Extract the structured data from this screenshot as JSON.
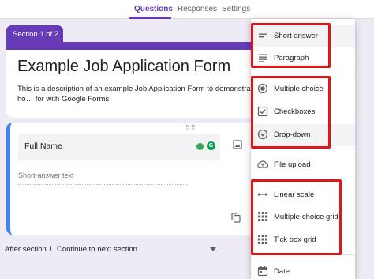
{
  "tabs": [
    {
      "label": "Questions",
      "active": true
    },
    {
      "label": "Responses",
      "active": false
    },
    {
      "label": "Settings",
      "active": false
    }
  ],
  "section_tab": "Section 1 of 2",
  "form": {
    "title": "Example Job Application Form",
    "description": "This is a description of an example Job Application Form to demonstrate ho… for with Google Forms."
  },
  "question": {
    "label": "Full Name",
    "placeholder": "Short-answer text",
    "badge": "G"
  },
  "after_section": {
    "label": "After section 1",
    "value": "Continue to next section"
  },
  "menu": {
    "items": [
      {
        "label": "Short answer",
        "icon": "short-answer-icon"
      },
      {
        "label": "Paragraph",
        "icon": "paragraph-icon"
      },
      {
        "label": "Multiple choice",
        "icon": "radio-icon"
      },
      {
        "label": "Checkboxes",
        "icon": "checkbox-icon"
      },
      {
        "label": "Drop-down",
        "icon": "dropdown-icon"
      },
      {
        "label": "File upload",
        "icon": "cloud-upload-icon"
      },
      {
        "label": "Linear scale",
        "icon": "linear-scale-icon"
      },
      {
        "label": "Multiple-choice grid",
        "icon": "grid-icon"
      },
      {
        "label": "Tick box grid",
        "icon": "grid-icon"
      },
      {
        "label": "Date",
        "icon": "calendar-icon"
      }
    ]
  },
  "colors": {
    "accent": "#673ab7",
    "highlight_box": "#e0141b",
    "question_accent": "#4285f4"
  }
}
